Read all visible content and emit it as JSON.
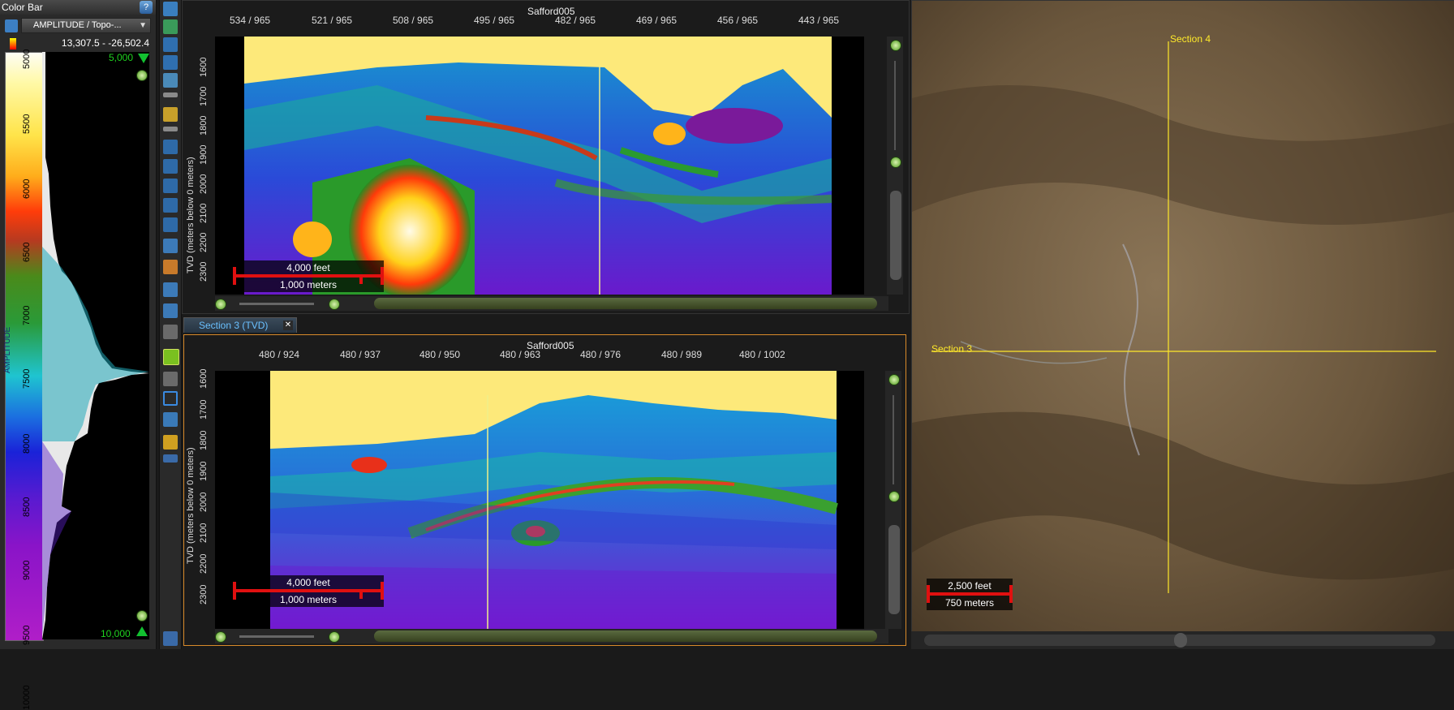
{
  "colorbar": {
    "title": "Color Bar",
    "help": "?",
    "attribute_select": "AMPLITUDE / Topo-...",
    "range": "13,307.5 - -26,502.4",
    "axis_label": "AMPLITUDE",
    "top_value": "5,000",
    "bottom_value": "10,000",
    "ticks": [
      "5000",
      "5500",
      "6000",
      "6500",
      "7000",
      "7500",
      "8000",
      "8500",
      "9000",
      "9500",
      "10000"
    ]
  },
  "section_top": {
    "title": "Safford005",
    "x_ticks": [
      "534 / 965",
      "521 / 965",
      "508 / 965",
      "495 / 965",
      "482 / 965",
      "469 / 965",
      "456 / 965",
      "443 / 965"
    ],
    "y_label": "TVD (meters below 0 meters)",
    "y_ticks": [
      "1600",
      "1700",
      "1800",
      "1900",
      "2000",
      "2100",
      "2200",
      "2300"
    ],
    "scale_feet": "4,000 feet",
    "scale_meters": "1,000 meters"
  },
  "section_bottom": {
    "tab_label": "Section 3 (TVD)",
    "title": "Safford005",
    "x_ticks": [
      "480 / 924",
      "480 / 937",
      "480 / 950",
      "480 / 963",
      "480 / 976",
      "480 / 989",
      "480 / 1002"
    ],
    "y_label": "TVD (meters below 0 meters)",
    "y_ticks": [
      "1600",
      "1700",
      "1800",
      "1900",
      "2000",
      "2100",
      "2200",
      "2300"
    ],
    "scale_feet": "4,000 feet",
    "scale_meters": "1,000 meters"
  },
  "map": {
    "section4_label": "Section 4",
    "section3_label": "Section 3",
    "scale_feet": "2,500 feet",
    "scale_meters": "750 meters"
  },
  "colors": {
    "accent": "#ffea2a",
    "scale_red": "#e01010",
    "tab_blue": "#6ac0ff",
    "panel_border_orange": "#d98a2a"
  }
}
